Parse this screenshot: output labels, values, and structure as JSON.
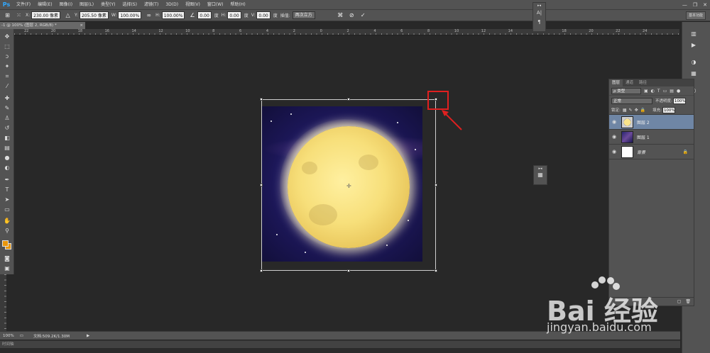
{
  "app": {
    "logo": "Ps"
  },
  "menu": [
    "文件(F)",
    "编辑(E)",
    "图像(I)",
    "图层(L)",
    "类型(Y)",
    "选择(S)",
    "滤镜(T)",
    "3D(D)",
    "视图(V)",
    "窗口(W)",
    "帮助(H)"
  ],
  "window_controls": {
    "minimize": "—",
    "restore": "❐",
    "close": "✕"
  },
  "options": {
    "x_label": "X:",
    "x_value": "230.00 像素",
    "y_label": "Y:",
    "y_value": "205.50 像素",
    "w_label": "W:",
    "w_value": "100.00%",
    "h_label": "H:",
    "h_value": "100.00%",
    "angle_value": "0.00",
    "angle_unit": "度",
    "hskew_label": "H:",
    "hskew_value": "0.00",
    "hskew_unit": "度",
    "vskew_label": "V:",
    "vskew_value": "0.00",
    "vskew_unit": "度",
    "interp_label": "插值:",
    "interp_value": "两次立方",
    "workspace": "基本功能"
  },
  "document_tab": {
    "title": "-1 @ 100% (图层 2, RGB/8) *",
    "close": "×"
  },
  "ruler_ticks": [
    "22",
    "20",
    "18",
    "16",
    "14",
    "12",
    "10",
    "8",
    "6",
    "4",
    "2",
    "0",
    "2",
    "4",
    "6",
    "8",
    "10",
    "12",
    "14",
    "16",
    "18",
    "20",
    "22",
    "24"
  ],
  "layers_panel": {
    "tabs": [
      "图层",
      "通道",
      "路径"
    ],
    "kind": "ρ 类型",
    "blend_mode": "正常",
    "opacity_label": "不透明度:",
    "opacity_value": "100%",
    "lock_label": "锁定:",
    "fill_label": "填充:",
    "fill_value": "100%",
    "layers": [
      {
        "name": "图层 2",
        "selected": true
      },
      {
        "name": "图层 1",
        "selected": false
      },
      {
        "name": "背景",
        "selected": false
      }
    ]
  },
  "status": {
    "zoom": "100%",
    "doc_info": "文档:509.2K/1.30M",
    "arrow": "▶"
  },
  "timeline": {
    "label": "时间轴"
  },
  "watermark": {
    "brand": "Bai 经验",
    "url": "jingyan.baidu.com"
  }
}
